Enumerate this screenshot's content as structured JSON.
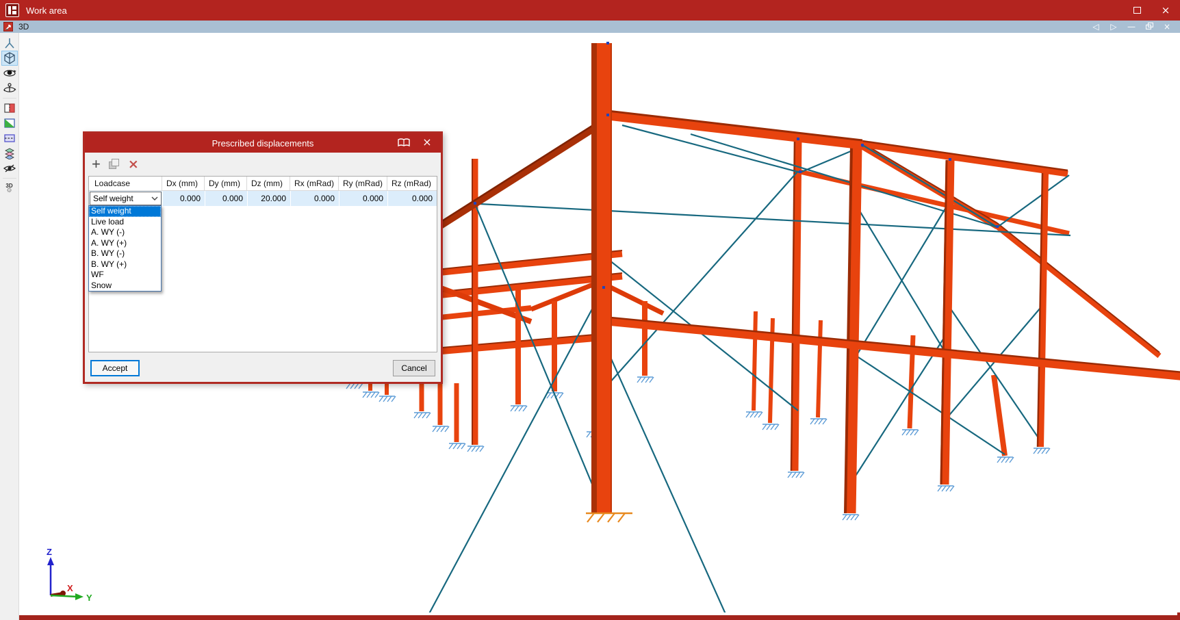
{
  "window": {
    "title": "Work area",
    "controls": {
      "maximize": "maximize-window",
      "close_glyph": "×"
    }
  },
  "tabbar": {
    "tab_label": "3D",
    "controls": {
      "back_glyph": "◁",
      "forward_glyph": "▷",
      "minimize_glyph": "—",
      "restore": "restore-window",
      "close_glyph": "×"
    }
  },
  "sidebar": {
    "active_tool": "view-cube-tool",
    "tools": [
      "frame-node-tool",
      "view-cube-tool",
      "orbit-tool",
      "pan-rotate-tool",
      "section-tool",
      "slope-view-tool",
      "clip-plane-tool",
      "layers-tool",
      "hide-elements-tool",
      "3d-settings-tool"
    ],
    "settings_tool_label": "3D",
    "settings_gear_glyph": "⚙"
  },
  "dialog": {
    "title": "Prescribed displacements",
    "toolbar": {
      "add_glyph": "+",
      "copy": "copy-row",
      "delete_glyph": "×"
    },
    "columns": [
      "Loadcase",
      "Dx (mm)",
      "Dy (mm)",
      "Dz (mm)",
      "Rx (mRad)",
      "Ry (mRad)",
      "Rz (mRad)"
    ],
    "row": {
      "loadcase": "Self weight",
      "values": [
        "0.000",
        "0.000",
        "20.000",
        "0.000",
        "0.000",
        "0.000"
      ]
    },
    "dropdown": {
      "selected": "Self weight",
      "options": [
        "Self weight",
        "Live load",
        "A. WY (-)",
        "A. WY (+)",
        "B. WY (-)",
        "B. WY (+)",
        "WF",
        "Snow"
      ]
    },
    "buttons": {
      "accept": "Accept",
      "cancel": "Cancel"
    }
  },
  "viewport": {
    "axes": {
      "x": "X",
      "y": "Y",
      "z": "Z"
    }
  },
  "colors": {
    "titlebar": "#B3241F",
    "tabbar": "#A9BFD3",
    "member": "#E8430E",
    "member_edge": "#9A2B05",
    "bracing": "#17687F",
    "support_blue": "#5B9BD5",
    "support_orange": "#E8891F",
    "row_selection": "#DCEDFB",
    "accent": "#0078D7",
    "dropdown_selection": "#0078D7"
  }
}
